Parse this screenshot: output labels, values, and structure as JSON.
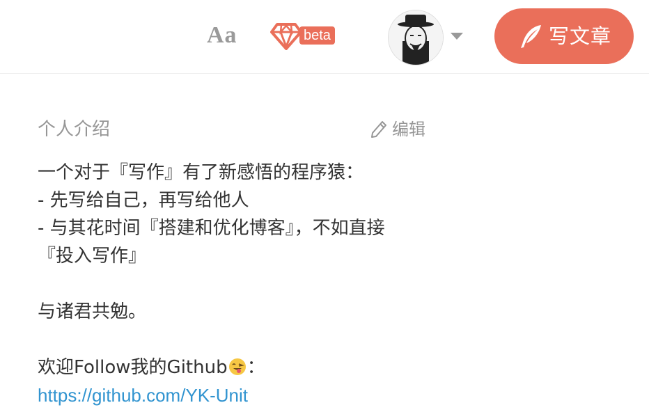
{
  "header": {
    "font_toggle_label": "Aa",
    "beta_label": "beta",
    "write_button_label": "写文章",
    "icons": {
      "font": "font-size-icon",
      "beta": "diamond-icon",
      "avatar": "user-avatar",
      "caret": "caret-down-icon",
      "write": "feather-pen-icon"
    }
  },
  "intro": {
    "title": "个人介绍",
    "edit_label": "编辑",
    "lines": [
      "一个对于『写作』有了新感悟的程序猿：",
      "- 先写给自己，再写给他人",
      "- 与其花时间『搭建和优化博客』，不如直接",
      "『投入写作』",
      "",
      "与诸君共勉。",
      ""
    ],
    "follow_text": "欢迎Follow我的Github",
    "follow_suffix": "：",
    "emoji": "winking-tongue-emoji",
    "link": "https://github.com/YK-Unit"
  },
  "colors": {
    "accent": "#ea6f5a",
    "link": "#3194d0",
    "muted_text": "#969696",
    "body_text": "#333333"
  }
}
